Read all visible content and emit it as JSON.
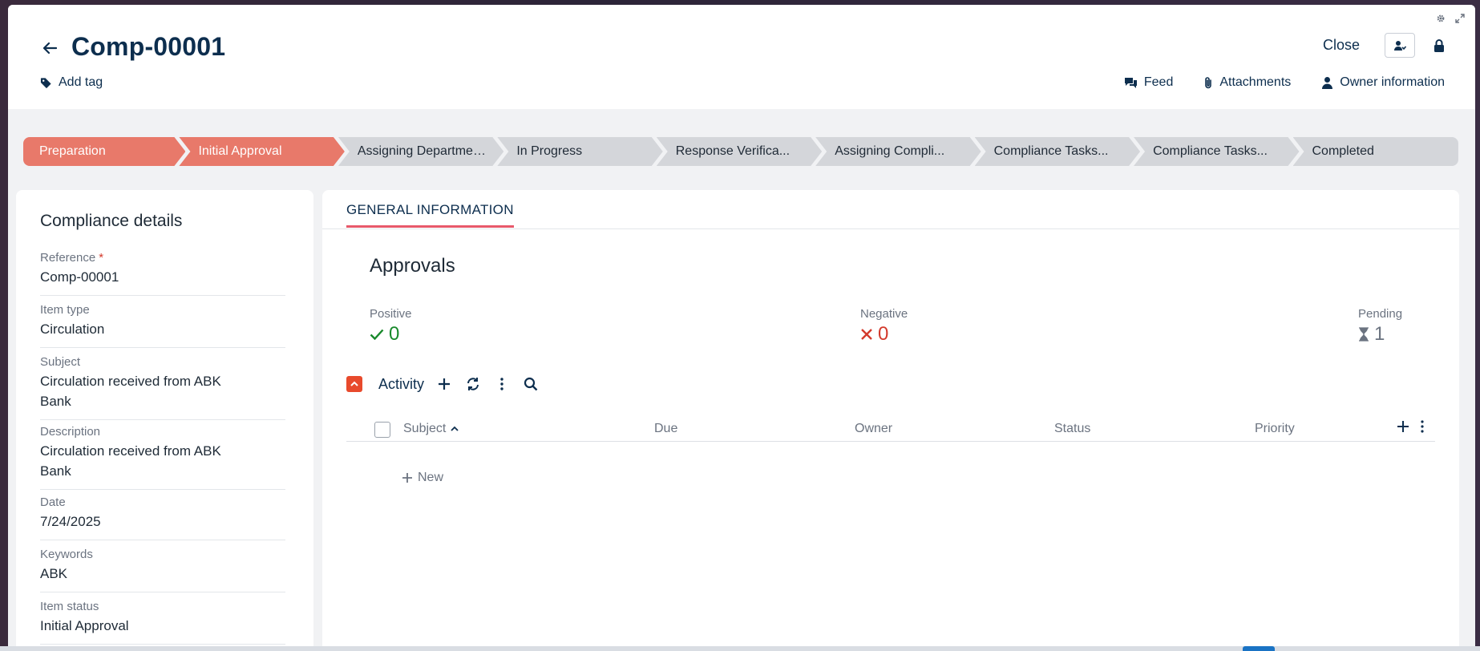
{
  "header": {
    "title": "Comp-00001",
    "add_tag": "Add tag",
    "close": "Close",
    "links": {
      "feed": "Feed",
      "attachments": "Attachments",
      "owner": "Owner information"
    }
  },
  "stages": [
    {
      "label": "Preparation",
      "state": "done"
    },
    {
      "label": "Initial Approval",
      "state": "done"
    },
    {
      "label": "Assigning Department Tasks",
      "state": "todo"
    },
    {
      "label": "In Progress",
      "state": "todo"
    },
    {
      "label": "Response Verifica...",
      "state": "todo"
    },
    {
      "label": "Assigning Compli...",
      "state": "todo"
    },
    {
      "label": "Compliance Tasks...",
      "state": "todo"
    },
    {
      "label": "Compliance Tasks...",
      "state": "todo"
    },
    {
      "label": "Completed",
      "state": "todo"
    }
  ],
  "details": {
    "title": "Compliance details",
    "fields": [
      {
        "label": "Reference",
        "value": "Comp-00001",
        "required": "*"
      },
      {
        "label": "Item type",
        "value": "Circulation"
      },
      {
        "label": "Subject",
        "value": "Circulation received from ABK Bank"
      },
      {
        "label": "Description",
        "value": "Circulation received from ABK Bank"
      },
      {
        "label": "Date",
        "value": "7/24/2025"
      },
      {
        "label": "Keywords",
        "value": "ABK"
      },
      {
        "label": "Item status",
        "value": "Initial Approval"
      }
    ]
  },
  "main": {
    "tab": "GENERAL INFORMATION",
    "approvals": {
      "title": "Approvals",
      "positive": {
        "label": "Positive",
        "value": "0"
      },
      "negative": {
        "label": "Negative",
        "value": "0"
      },
      "pending": {
        "label": "Pending",
        "value": "1"
      }
    },
    "activity": {
      "label": "Activity",
      "columns": [
        "Subject",
        "Due",
        "Owner",
        "Status",
        "Priority"
      ],
      "new_label": "New"
    }
  },
  "colors": {
    "stage_done": "#e8796a",
    "stage_todo": "#d4d6da",
    "positive": "#18892b",
    "negative": "#d33a2c",
    "accent": "#e84a2c",
    "text": "#0d2e4e"
  }
}
